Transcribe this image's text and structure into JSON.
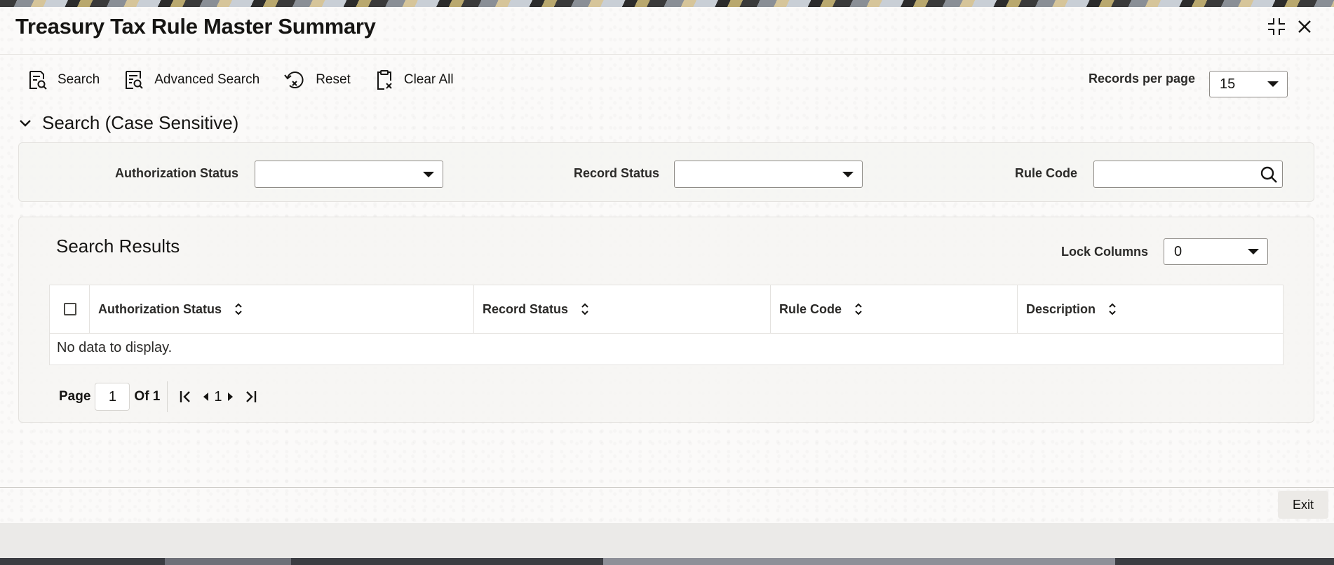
{
  "window": {
    "title": "Treasury Tax Rule Master Summary"
  },
  "toolbar": {
    "search_label": "Search",
    "advanced_search_label": "Advanced Search",
    "reset_label": "Reset",
    "clear_all_label": "Clear All",
    "records_per_page_label": "Records per page",
    "records_per_page_value": "15"
  },
  "search_section": {
    "title": "Search (Case Sensitive)",
    "authorization_status_label": "Authorization Status",
    "authorization_status_value": "",
    "record_status_label": "Record Status",
    "record_status_value": "",
    "rule_code_label": "Rule Code",
    "rule_code_value": ""
  },
  "results": {
    "title": "Search Results",
    "lock_columns_label": "Lock Columns",
    "lock_columns_value": "0",
    "columns": [
      "Authorization Status",
      "Record Status",
      "Rule Code",
      "Description"
    ],
    "empty_text": "No data to display."
  },
  "pagination": {
    "page_label": "Page",
    "current_page": "1",
    "of_label": "Of 1",
    "page_number": "1"
  },
  "footer": {
    "exit_label": "Exit"
  }
}
